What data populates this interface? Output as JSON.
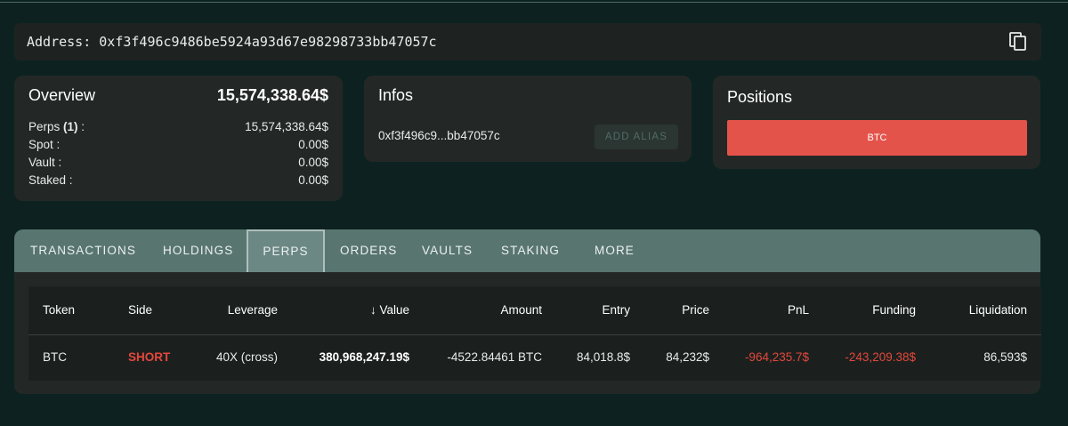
{
  "address": {
    "label": "Address: 0xf3f496c9486be5924a93d67e98298733bb47057c",
    "copy_icon": "copy-icon"
  },
  "overview": {
    "title": "Overview",
    "total": "15,574,338.64$",
    "rows": [
      {
        "label": "Perps",
        "count": "(1)",
        "suffix": " :",
        "value": "15,574,338.64$"
      },
      {
        "label": "Spot :",
        "value": "0.00$"
      },
      {
        "label": "Vault :",
        "value": "0.00$"
      },
      {
        "label": "Staked :",
        "value": "0.00$"
      }
    ]
  },
  "infos": {
    "title": "Infos",
    "address_short": "0xf3f496c9...bb47057c",
    "alias_button": "ADD ALIAS"
  },
  "positions": {
    "title": "Positions",
    "items": [
      "BTC"
    ],
    "color": "#e4534a"
  },
  "tabs": [
    {
      "label": "TRANSACTIONS"
    },
    {
      "label": "HOLDINGS"
    },
    {
      "label": "PERPS",
      "active": true
    },
    {
      "label": "ORDERS"
    },
    {
      "label": "VAULTS"
    },
    {
      "label": "STAKING"
    },
    {
      "label": "MORE"
    }
  ],
  "table": {
    "headers": {
      "token": "Token",
      "side": "Side",
      "leverage": "Leverage",
      "value_arrow": "↓",
      "value": "Value",
      "amount": "Amount",
      "entry": "Entry",
      "price": "Price",
      "pnl": "PnL",
      "funding": "Funding",
      "liquidation": "Liquidation"
    },
    "rows": [
      {
        "token": "BTC",
        "side": "SHORT",
        "leverage": "40X (cross)",
        "value": "380,968,247.19$",
        "amount": "-4522.84461 BTC",
        "entry": "84,018.8$",
        "price": "84,232$",
        "pnl": "-964,235.7$",
        "funding": "-243,209.38$",
        "liquidation": "86,593$"
      }
    ]
  },
  "colors": {
    "background": "#0d2220",
    "card": "#232826",
    "tab_bar": "#587570",
    "negative": "#e3473c",
    "short": "#e3473c"
  }
}
